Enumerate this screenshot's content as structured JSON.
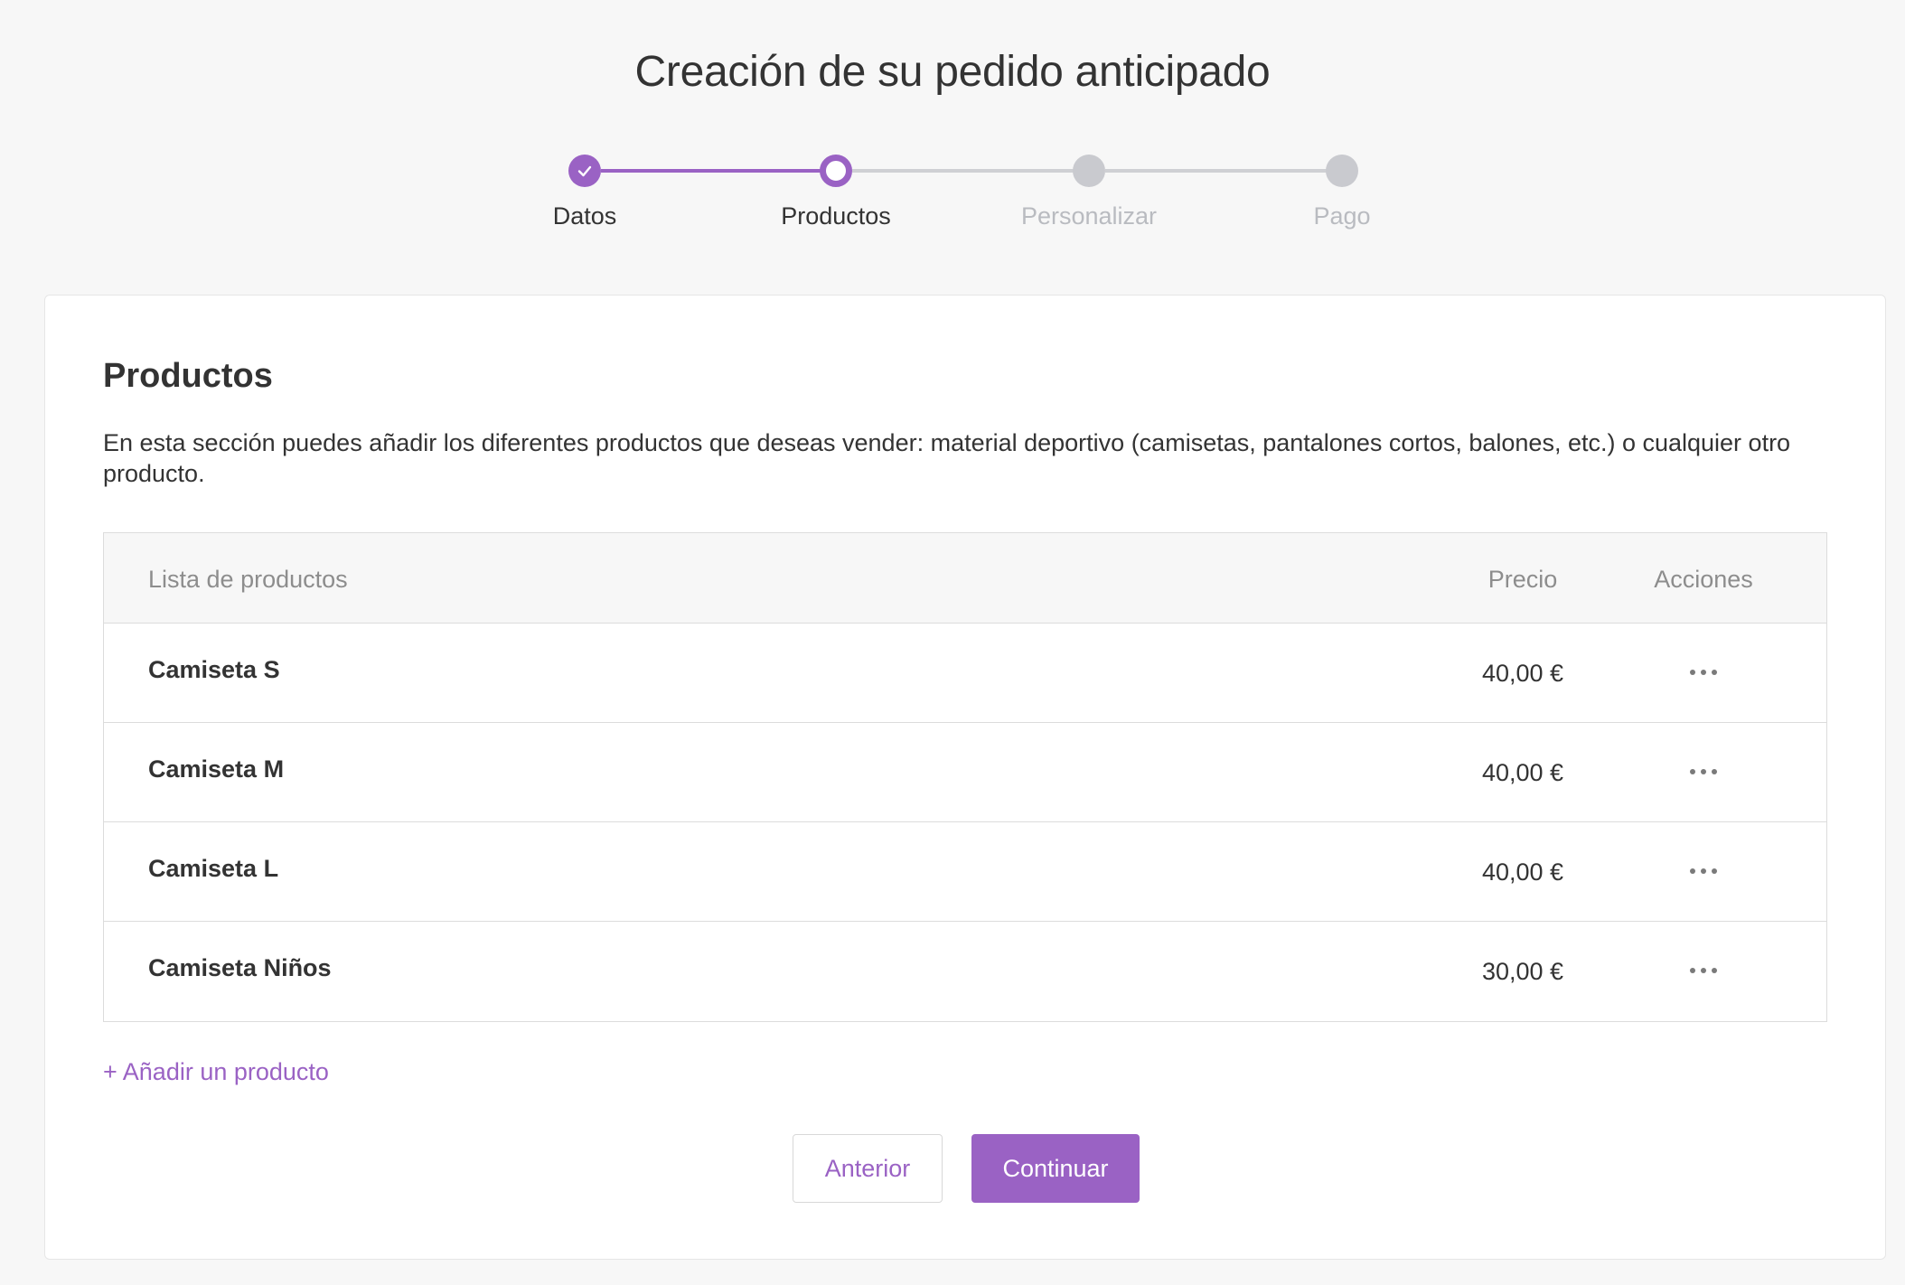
{
  "page": {
    "title": "Creación de su pedido anticipado"
  },
  "stepper": {
    "steps": [
      {
        "label": "Datos",
        "state": "complete"
      },
      {
        "label": "Productos",
        "state": "current"
      },
      {
        "label": "Personalizar",
        "state": "pending"
      },
      {
        "label": "Pago",
        "state": "pending"
      }
    ]
  },
  "section": {
    "title": "Productos",
    "description": "En esta sección puedes añadir los diferentes productos que deseas vender: material deportivo (camisetas, pantalones cortos, balones, etc.) o cualquier otro producto."
  },
  "table": {
    "headers": {
      "name": "Lista de productos",
      "price": "Precio",
      "actions": "Acciones"
    },
    "rows": [
      {
        "name": "Camiseta S",
        "price": "40,00 €"
      },
      {
        "name": "Camiseta M",
        "price": "40,00 €"
      },
      {
        "name": "Camiseta L",
        "price": "40,00 €"
      },
      {
        "name": "Camiseta Niños",
        "price": "30,00 €"
      }
    ]
  },
  "actions": {
    "add_product": "+ Añadir un producto",
    "previous": "Anterior",
    "continue": "Continuar"
  },
  "colors": {
    "accent": "#9a62c4",
    "pending": "#c9cacf"
  }
}
